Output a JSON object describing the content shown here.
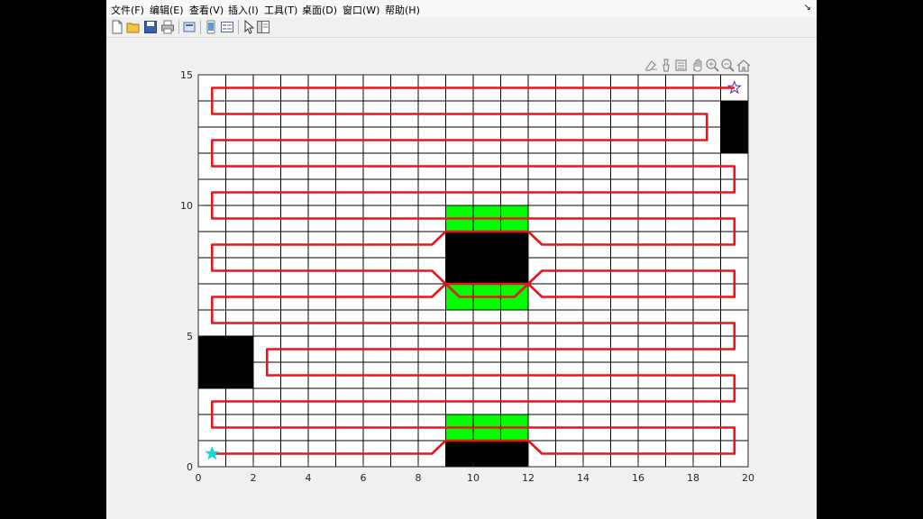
{
  "menu": [
    "文件(F)",
    "编辑(E)",
    "查看(V)",
    "插入(I)",
    "工具(T)",
    "桌面(D)",
    "窗口(W)",
    "帮助(H)"
  ],
  "menu_restore_glyph": "↘",
  "toolbar_icons": [
    "new-figure-icon",
    "open-file-icon",
    "save-icon",
    "print-icon",
    "print-preview-icon",
    "link-plot-icon",
    "insert-legend-icon",
    "pointer-icon",
    "property-editor-icon"
  ],
  "axes_toolbar_icons": [
    "export-icon",
    "brush-icon",
    "data-tips-icon",
    "pan-icon",
    "zoom-in-icon",
    "zoom-out-icon",
    "home-icon"
  ],
  "chart_data": {
    "type": "grid-path",
    "xlim": [
      0,
      20
    ],
    "ylim": [
      0,
      15
    ],
    "x_ticks": [
      "0",
      "2",
      "4",
      "6",
      "8",
      "10",
      "12",
      "14",
      "16",
      "18",
      "20"
    ],
    "y_ticks": [
      "0",
      "5",
      "10",
      "15"
    ],
    "grid": {
      "x_lines": [
        1,
        2,
        3,
        4,
        5,
        6,
        7,
        8,
        9,
        10,
        11,
        12,
        13,
        14,
        15,
        16,
        17,
        18,
        19
      ],
      "y_lines": [
        1,
        2,
        3,
        4,
        5,
        6,
        7,
        8,
        9,
        10,
        11,
        12,
        13,
        14
      ]
    },
    "colors": {
      "obstacle": "#000000",
      "highlight": "#00ff00",
      "path": "#e8161b",
      "start": "#19d8d8",
      "goal": "#7030a0"
    },
    "obstacles": [
      {
        "x0": 9,
        "x1": 12,
        "y0": 0,
        "y1": 1
      },
      {
        "x0": 9,
        "x1": 12,
        "y0": 7,
        "y1": 9
      },
      {
        "x0": 0,
        "x1": 2,
        "y0": 3,
        "y1": 5
      },
      {
        "x0": 19,
        "x1": 20,
        "y0": 12,
        "y1": 14
      }
    ],
    "highlights": [
      {
        "x0": 9,
        "x1": 12,
        "y0": 1,
        "y1": 2
      },
      {
        "x0": 9,
        "x1": 12,
        "y0": 6,
        "y1": 7
      },
      {
        "x0": 9,
        "x1": 12,
        "y0": 9,
        "y1": 10
      }
    ],
    "start": [
      0.5,
      0.5
    ],
    "goal": [
      19.5,
      14.5
    ],
    "path": [
      [
        0.5,
        0.5
      ],
      [
        8.5,
        0.5
      ],
      [
        9,
        1
      ],
      [
        12,
        1
      ],
      [
        12.5,
        0.5
      ],
      [
        19.5,
        0.5
      ],
      [
        19.5,
        1.5
      ],
      [
        0.5,
        1.5
      ],
      [
        0.5,
        2.5
      ],
      [
        19.5,
        2.5
      ],
      [
        19.5,
        3.5
      ],
      [
        2.5,
        3.5
      ],
      [
        2.5,
        4.5
      ],
      [
        19.5,
        4.5
      ],
      [
        19.5,
        5.5
      ],
      [
        0.5,
        5.5
      ],
      [
        0.5,
        6.5
      ],
      [
        8.5,
        6.5
      ],
      [
        9,
        7
      ],
      [
        9.5,
        6.5
      ],
      [
        11.5,
        6.5
      ],
      [
        12,
        7
      ],
      [
        12.5,
        7.5
      ],
      [
        19.5,
        7.5
      ],
      [
        19.5,
        6.5
      ],
      [
        12.5,
        6.5
      ],
      [
        12,
        7
      ],
      [
        9,
        7
      ],
      [
        8.5,
        7.5
      ],
      [
        0.5,
        7.5
      ],
      [
        0.5,
        8.5
      ],
      [
        8.5,
        8.5
      ],
      [
        9,
        9
      ],
      [
        12,
        9
      ],
      [
        12.5,
        8.5
      ],
      [
        19.5,
        8.5
      ],
      [
        19.5,
        9.5
      ],
      [
        0.5,
        9.5
      ],
      [
        0.5,
        10.5
      ],
      [
        19.5,
        10.5
      ],
      [
        19.5,
        11.5
      ],
      [
        0.5,
        11.5
      ],
      [
        0.5,
        12.5
      ],
      [
        18.5,
        12.5
      ],
      [
        18.5,
        13.5
      ],
      [
        0.5,
        13.5
      ],
      [
        0.5,
        14.5
      ],
      [
        19.5,
        14.5
      ]
    ]
  }
}
